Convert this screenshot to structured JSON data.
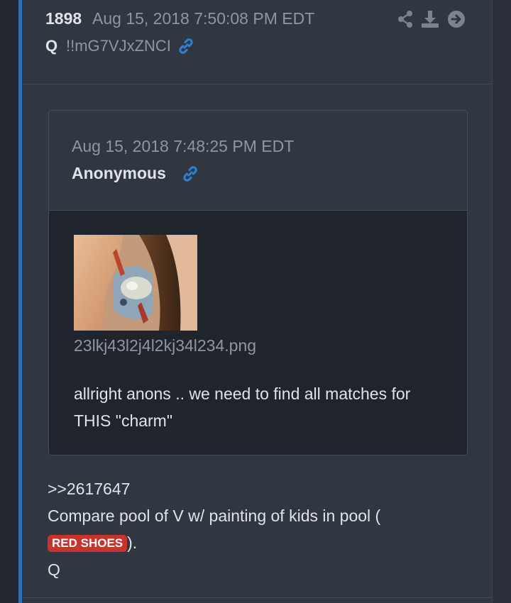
{
  "post": {
    "number": "1898",
    "date": "Aug 15, 2018 7:50:08 PM EDT",
    "author": "Q",
    "tripcode": "!!mG7VJxZNCI",
    "actions": [
      "share-icon",
      "download-icon",
      "go-arrow-icon"
    ]
  },
  "quoted": {
    "date": "Aug 15, 2018 7:48:25 PM EDT",
    "author": "Anonymous",
    "filename": "23lkj43l2j4l2kj34l234.png",
    "text": "allright anons .. we need to find all matches for THIS \"charm\""
  },
  "body": {
    "ref": ">>2617647",
    "line1": "Compare pool of V w/ painting of kids in pool (",
    "badge": "RED SHOES",
    "line2_tail": ").",
    "signature": "Q"
  },
  "colors": {
    "accent": "#2f6fb4",
    "link": "#2f7fd1",
    "badge": "#c8332d",
    "background": "#2b303a"
  }
}
